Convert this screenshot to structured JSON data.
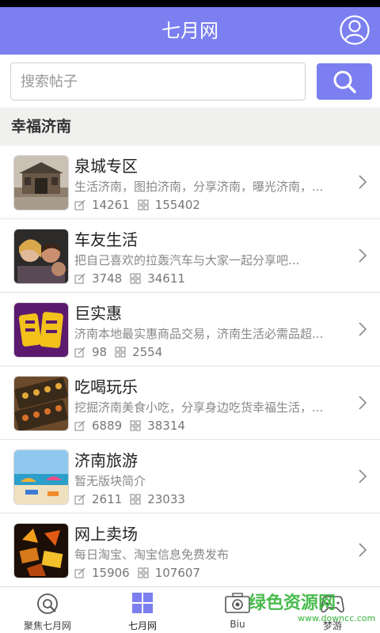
{
  "header": {
    "title": "七月网"
  },
  "search": {
    "placeholder": "搜索帖子"
  },
  "section": {
    "title": "幸福济南"
  },
  "items": [
    {
      "title": "泉城专区",
      "desc": "生活济南，图拍济南，分享济南，曝光济南，...",
      "posts": "14261",
      "views": "155402",
      "thumb": "gate-image"
    },
    {
      "title": "车友生活",
      "desc": "把自己喜欢的拉轰汽车与大家一起分享吧...",
      "posts": "3748",
      "views": "34611",
      "thumb": "friends-image"
    },
    {
      "title": "巨实惠",
      "desc": "济南本地最实惠商品交易，济南生活必需品超...",
      "posts": "98",
      "views": "2554",
      "thumb": "logo-image"
    },
    {
      "title": "吃喝玩乐",
      "desc": "挖掘济南美食小吃，分享身边吃货幸福生活，...",
      "posts": "6889",
      "views": "38314",
      "thumb": "food-image"
    },
    {
      "title": "济南旅游",
      "desc": "暂无版块简介",
      "posts": "2611",
      "views": "23033",
      "thumb": "beach-image"
    },
    {
      "title": "网上卖场",
      "desc": "每日淘宝、淘宝信息免费发布",
      "posts": "15906",
      "views": "107607",
      "thumb": "shopping-image"
    }
  ],
  "tabs": [
    {
      "label": "聚焦七月网",
      "icon": "focus-icon"
    },
    {
      "label": "七月网",
      "icon": "grid-icon"
    },
    {
      "label": "Biu",
      "icon": "camera-icon"
    },
    {
      "label": "梦游",
      "icon": "gamepad-icon"
    }
  ],
  "watermark": {
    "text": "绿色资源网",
    "url": "www.downcc.com"
  },
  "colors": {
    "accent": "#7b7ff0",
    "watermark": "#37b43c"
  }
}
